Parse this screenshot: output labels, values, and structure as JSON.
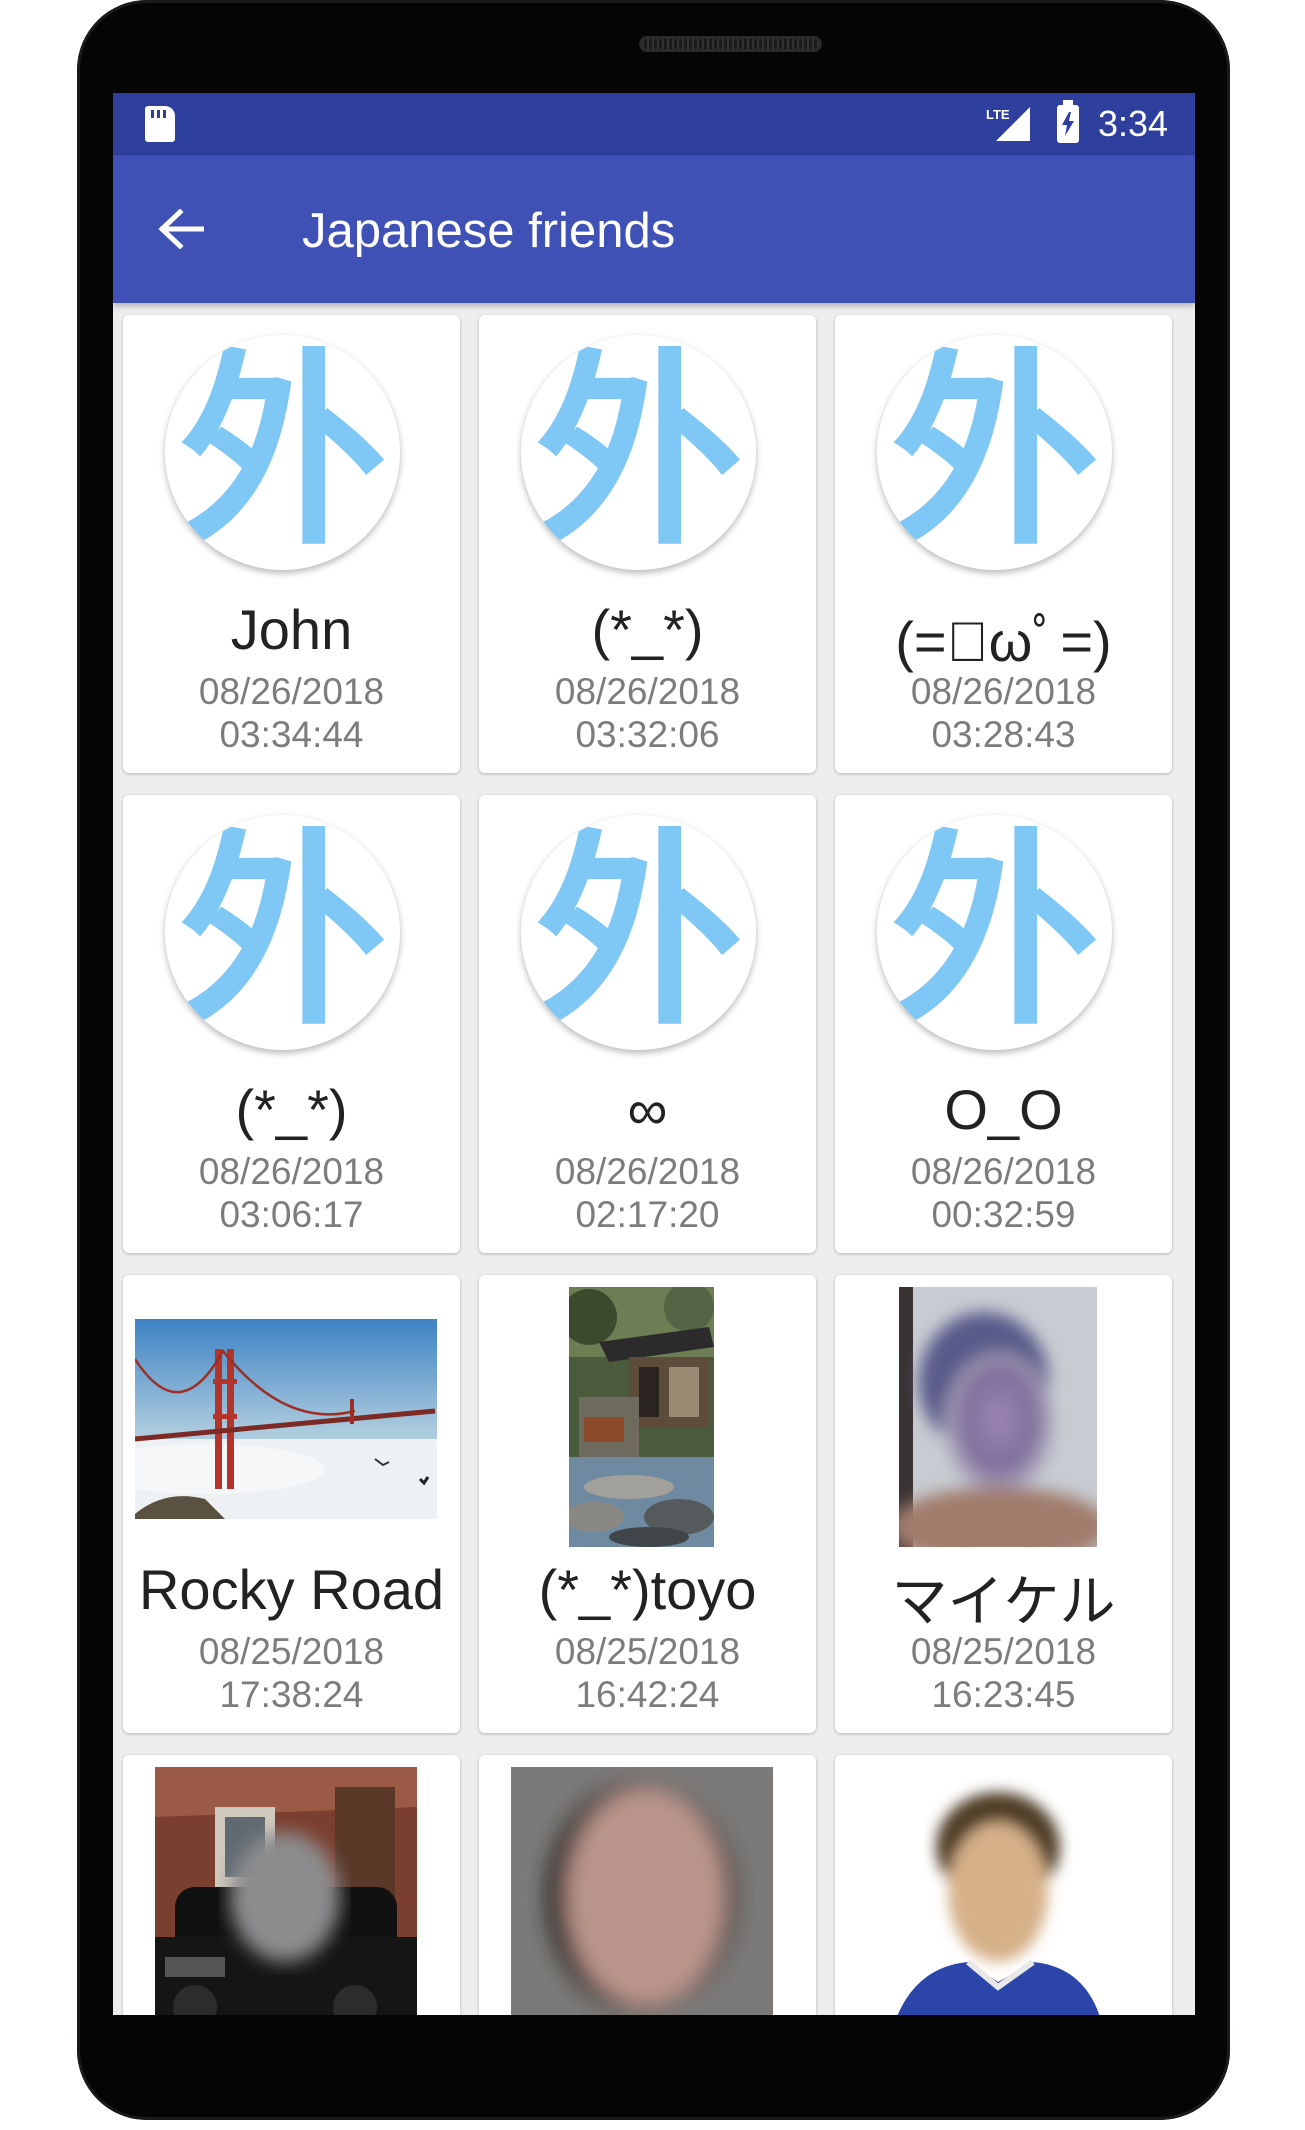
{
  "status_bar": {
    "time": "3:34",
    "network": "LTE"
  },
  "toolbar": {
    "title": "Japanese friends",
    "back_icon": "arrow-left-icon"
  },
  "avatar_glyph": "外",
  "colors": {
    "status_bar": "#2f3f9e",
    "toolbar": "#3f51b5",
    "avatar_glyph": "#7fc7f4"
  },
  "friends": [
    {
      "name": "John",
      "date": "08/26/2018",
      "time": "03:34:44",
      "avatar": "default"
    },
    {
      "name": "(*_*)",
      "date": "08/26/2018",
      "time": "03:32:06",
      "avatar": "default"
    },
    {
      "name": "(=ﾟωﾟ=)",
      "date": "08/26/2018",
      "time": "03:28:43",
      "avatar": "default"
    },
    {
      "name": "(*_*)",
      "date": "08/26/2018",
      "time": "03:06:17",
      "avatar": "default"
    },
    {
      "name": "∞",
      "date": "08/26/2018",
      "time": "02:17:20",
      "avatar": "default"
    },
    {
      "name": "O_O",
      "date": "08/26/2018",
      "time": "00:32:59",
      "avatar": "default"
    },
    {
      "name": "Rocky Road",
      "date": "08/25/2018",
      "time": "17:38:24",
      "avatar": "golden-gate-bridge-photo"
    },
    {
      "name": "(*_*)toyo",
      "date": "08/25/2018",
      "time": "16:42:24",
      "avatar": "japanese-garden-photo"
    },
    {
      "name": "マイケル",
      "date": "08/25/2018",
      "time": "16:23:45",
      "avatar": "blurred-face-photo"
    },
    {
      "name": "",
      "date": "",
      "time": "",
      "avatar": "car-house-photo"
    },
    {
      "name": "",
      "date": "",
      "time": "",
      "avatar": "bald-man-photo"
    },
    {
      "name": "",
      "date": "",
      "time": "",
      "avatar": "id-photo"
    }
  ]
}
